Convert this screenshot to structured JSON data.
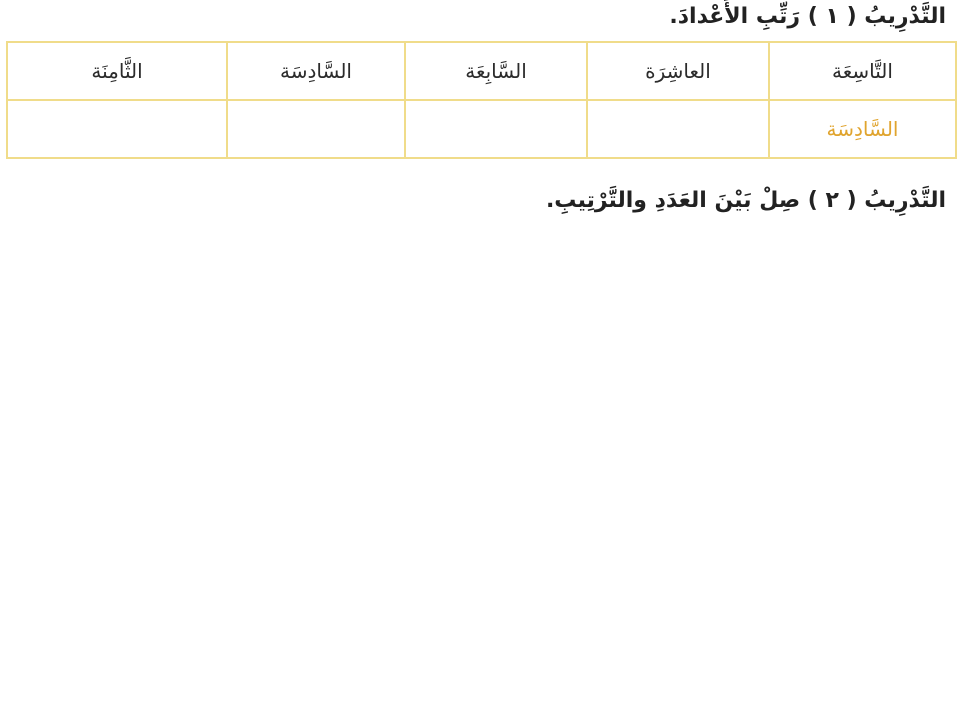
{
  "exercise_1": {
    "heading": "التَّدْرِيبُ ( ١ ) رَتِّبِ الأَعْدادَ."
  },
  "table": {
    "header_row": [
      "التَّاسِعَة",
      "العاشِرَة",
      "السَّابِعَة",
      "السَّادِسَة",
      "الثَّامِنَة"
    ],
    "answer_row": [
      "السَّادِسَة",
      "",
      "",
      "",
      ""
    ],
    "answer_color": "#e0a42e",
    "border_color": "#f0dc8a"
  },
  "exercise_2": {
    "heading": "التَّدْرِيبُ ( ٢ ) صِلْ بَيْنَ العَدَدِ والتَّرْتِيبِ."
  }
}
